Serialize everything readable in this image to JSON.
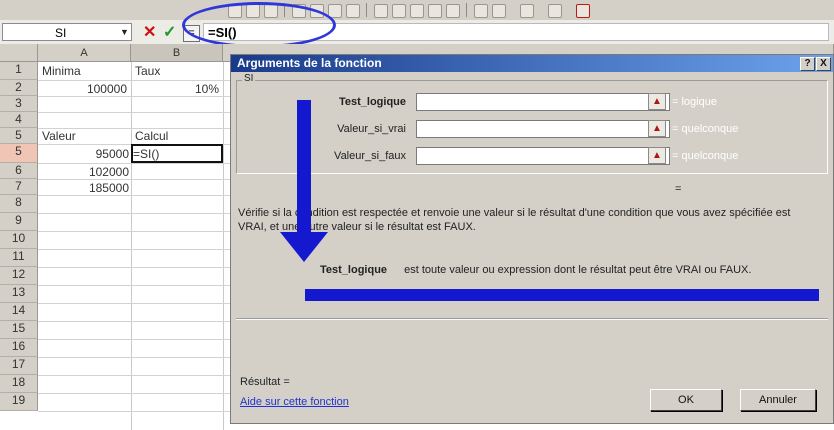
{
  "formula_bar": {
    "name_box": "SI",
    "cancel_symbol": "✕",
    "enter_symbol": "✓",
    "fx_symbol": "=",
    "formula": "=SI()"
  },
  "grid": {
    "columns": [
      "A",
      "B"
    ],
    "rows": [
      "1",
      "2",
      "3",
      "4",
      "5",
      "6",
      "7",
      "8",
      "9",
      "10",
      "11",
      "12",
      "13",
      "14",
      "15",
      "16",
      "17",
      "18",
      "19"
    ],
    "cells": {
      "a1": "Minima",
      "b1": "Taux",
      "a2": "100000",
      "b2": "10%",
      "a4": "Valeur",
      "b4": "Calcul",
      "a5": "95000",
      "b5": "=SI()",
      "a6": "102000",
      "a7": "185000"
    }
  },
  "dialog": {
    "title": "Arguments de la fonction",
    "help_btn": "?",
    "close_btn": "X",
    "function_name": "SI",
    "args": [
      {
        "label": "Test_logique",
        "result": "logique"
      },
      {
        "label": "Valeur_si_vrai",
        "result": "quelconque"
      },
      {
        "label": "Valeur_si_faux",
        "result": "quelconque"
      }
    ],
    "equals": "=",
    "description": "Vérifie si la condition est respectée et renvoie une valeur si le résultat d'une condition que vous avez spécifiée est VRAI, et une autre valeur si le résultat est FAUX.",
    "arg_help_name": "Test_logique",
    "arg_help_text": "est toute valeur ou expression dont le résultat peut être VRAI ou FAUX.",
    "result_label": "Résultat =",
    "help_link": "Aide sur cette fonction",
    "ok_label": "OK",
    "cancel_label": "Annuler"
  }
}
